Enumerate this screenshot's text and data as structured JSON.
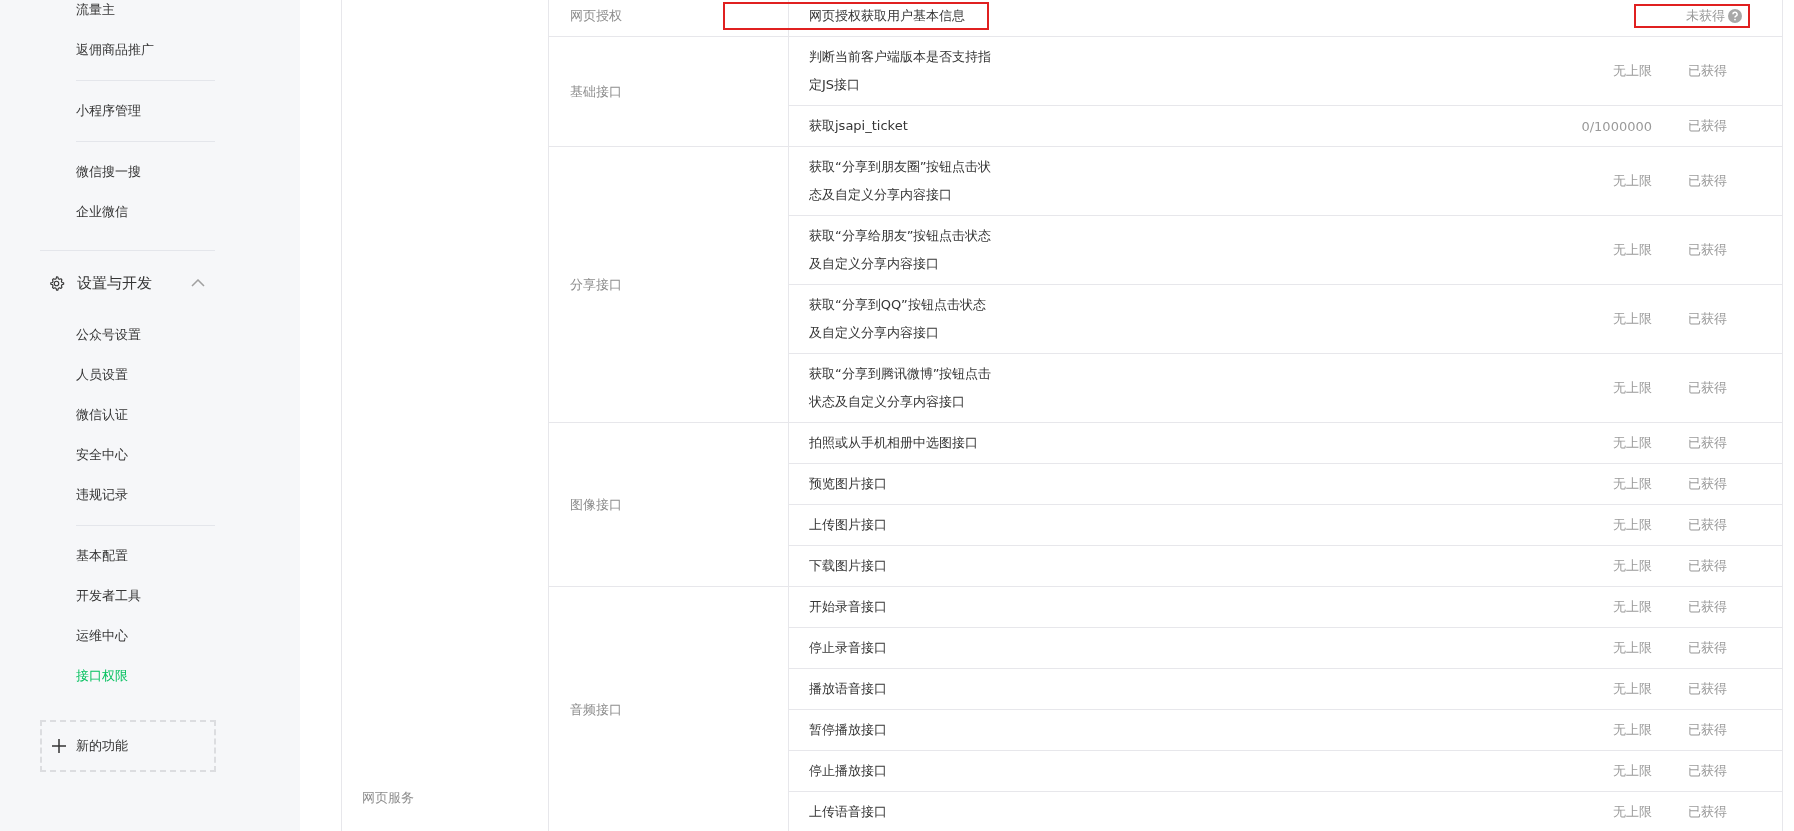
{
  "sidebar": {
    "groups": [
      {
        "items": [
          {
            "label": "流量主",
            "selected": false
          },
          {
            "label": "返佣商品推广",
            "selected": false
          }
        ]
      },
      {
        "items": [
          {
            "label": "小程序管理",
            "selected": false
          }
        ]
      },
      {
        "items": [
          {
            "label": "微信搜一搜",
            "selected": false
          },
          {
            "label": "企业微信",
            "selected": false
          }
        ]
      }
    ],
    "section": {
      "title": "设置与开发",
      "expanded": true,
      "groups": [
        {
          "items": [
            {
              "label": "公众号设置",
              "selected": false
            },
            {
              "label": "人员设置",
              "selected": false
            },
            {
              "label": "微信认证",
              "selected": false
            },
            {
              "label": "安全中心",
              "selected": false
            },
            {
              "label": "违规记录",
              "selected": false
            }
          ]
        },
        {
          "items": [
            {
              "label": "基本配置",
              "selected": false
            },
            {
              "label": "开发者工具",
              "selected": false
            },
            {
              "label": "运维中心",
              "selected": false
            },
            {
              "label": "接口权限",
              "selected": true
            }
          ]
        }
      ]
    },
    "add_button": "新的功能"
  },
  "main": {
    "category": "网页服务",
    "groups": [
      {
        "name": "网页授权",
        "rows": [
          {
            "name_lines": [
              "网页授权获取用户基本信息"
            ],
            "status": "未获得",
            "help": true,
            "highlighted": true
          }
        ]
      },
      {
        "name": "基础接口",
        "rows": [
          {
            "name_lines": [
              "判断当前客户端版本是否支持指",
              "定JS接口"
            ],
            "quota": "无上限",
            "status": "已获得",
            "help": false,
            "highlighted": false
          },
          {
            "name_lines": [
              "获取jsapi_ticket"
            ],
            "quota": "0/1000000",
            "status": "已获得",
            "help": false,
            "highlighted": false
          }
        ]
      },
      {
        "name": "分享接口",
        "rows": [
          {
            "name_lines": [
              "获取“分享到朋友圈”按钮点击状",
              "态及自定义分享内容接口"
            ],
            "quota": "无上限",
            "status": "已获得",
            "help": false,
            "highlighted": false
          },
          {
            "name_lines": [
              "获取“分享给朋友”按钮点击状态",
              "及自定义分享内容接口"
            ],
            "quota": "无上限",
            "status": "已获得",
            "help": false,
            "highlighted": false
          },
          {
            "name_lines": [
              "获取“分享到QQ”按钮点击状态",
              "及自定义分享内容接口"
            ],
            "quota": "无上限",
            "status": "已获得",
            "help": false,
            "highlighted": false
          },
          {
            "name_lines": [
              "获取“分享到腾讯微博”按钮点击",
              "状态及自定义分享内容接口"
            ],
            "quota": "无上限",
            "status": "已获得",
            "help": false,
            "highlighted": false
          }
        ]
      },
      {
        "name": "图像接口",
        "rows": [
          {
            "name_lines": [
              "拍照或从手机相册中选图接口"
            ],
            "quota": "无上限",
            "status": "已获得",
            "help": false,
            "highlighted": false
          },
          {
            "name_lines": [
              "预览图片接口"
            ],
            "quota": "无上限",
            "status": "已获得",
            "help": false,
            "highlighted": false
          },
          {
            "name_lines": [
              "上传图片接口"
            ],
            "quota": "无上限",
            "status": "已获得",
            "help": false,
            "highlighted": false
          },
          {
            "name_lines": [
              "下载图片接口"
            ],
            "quota": "无上限",
            "status": "已获得",
            "help": false,
            "highlighted": false
          }
        ]
      },
      {
        "name": "音频接口",
        "rows": [
          {
            "name_lines": [
              "开始录音接口"
            ],
            "quota": "无上限",
            "status": "已获得",
            "help": false,
            "highlighted": false
          },
          {
            "name_lines": [
              "停止录音接口"
            ],
            "quota": "无上限",
            "status": "已获得",
            "help": false,
            "highlighted": false
          },
          {
            "name_lines": [
              "播放语音接口"
            ],
            "quota": "无上限",
            "status": "已获得",
            "help": false,
            "highlighted": false
          },
          {
            "name_lines": [
              "暂停播放接口"
            ],
            "quota": "无上限",
            "status": "已获得",
            "help": false,
            "highlighted": false
          },
          {
            "name_lines": [
              "停止播放接口"
            ],
            "quota": "无上限",
            "status": "已获得",
            "help": false,
            "highlighted": false
          },
          {
            "name_lines": [
              "上传语音接口"
            ],
            "quota": "无上限",
            "status": "已获得",
            "help": false,
            "highlighted": false
          }
        ]
      }
    ]
  }
}
